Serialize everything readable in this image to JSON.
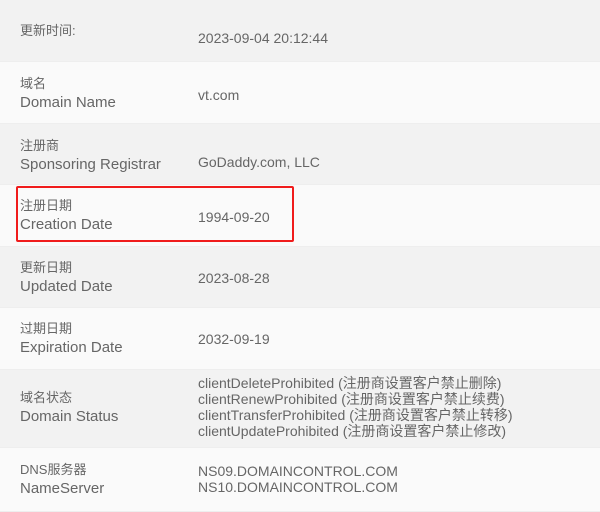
{
  "rows": [
    {
      "cn": "更新时间:",
      "en": "",
      "values": [
        "2023-09-04 20:12:44"
      ]
    },
    {
      "cn": "域名",
      "en": "Domain Name",
      "values": [
        "vt.com"
      ]
    },
    {
      "cn": "注册商",
      "en": "Sponsoring Registrar",
      "values": [
        "GoDaddy.com, LLC"
      ]
    },
    {
      "cn": "注册日期",
      "en": "Creation Date",
      "values": [
        "1994-09-20"
      ]
    },
    {
      "cn": "更新日期",
      "en": "Updated Date",
      "values": [
        "2023-08-28"
      ]
    },
    {
      "cn": "过期日期",
      "en": "Expiration Date",
      "values": [
        "2032-09-19"
      ]
    },
    {
      "cn": "域名状态",
      "en": "Domain Status",
      "values": [
        "clientDeleteProhibited (注册商设置客户禁止删除)",
        "clientRenewProhibited (注册商设置客户禁止续费)",
        "clientTransferProhibited (注册商设置客户禁止转移)",
        "clientUpdateProhibited (注册商设置客户禁止修改)"
      ]
    },
    {
      "cn": "DNS服务器",
      "en": "NameServer",
      "values": [
        "NS09.DOMAINCONTROL.COM",
        "NS10.DOMAINCONTROL.COM"
      ]
    }
  ],
  "highlight_color": "#f01c1c"
}
